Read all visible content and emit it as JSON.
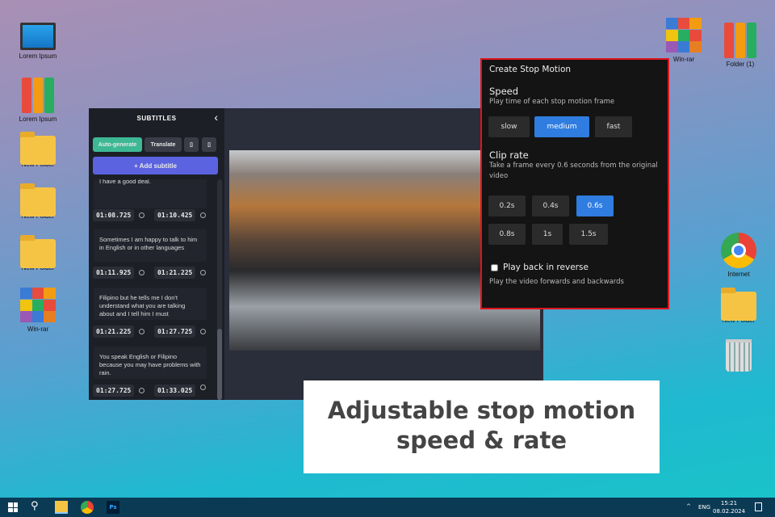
{
  "desktop": {
    "left_icons": [
      "Lorem Ipsum",
      "Lorem Ipsum",
      "New Folder",
      "New Folder",
      "New Folder",
      "Win-rar"
    ],
    "right_icons": [
      "Win-rar",
      "Folder (1)",
      "Internet",
      "New Folder"
    ]
  },
  "subtitles": {
    "title": "SUBTITLES",
    "auto_generate": "Auto-generate",
    "translate": "Translate",
    "add_subtitle": "+ Add subtitle",
    "items": [
      {
        "text": "I have a good deal.",
        "start": "01:08.725",
        "end": "01:10.425"
      },
      {
        "text": "Sometimes I am happy to talk to him in English or in other languages",
        "start": "01:11.925",
        "end": "01:21.225"
      },
      {
        "text": "Filipino but he tells me I don't understand what you are talking about and I tell him I must",
        "start": "01:21.225",
        "end": "01:27.725"
      },
      {
        "text": "You speak English or Filipino because you may have problems with rain.",
        "start": "01:27.725",
        "end": "01:33.025"
      }
    ]
  },
  "stop_motion": {
    "title": "Create Stop Motion",
    "speed_label": "Speed",
    "speed_desc": "Play time of each stop motion frame",
    "speeds": [
      "slow",
      "medium",
      "fast"
    ],
    "speed_selected": "medium",
    "clip_label": "Clip rate",
    "clip_desc": "Take a frame every 0.6 seconds from the original video",
    "rates": [
      "0.2s",
      "0.4s",
      "0.6s",
      "0.8s",
      "1s",
      "1.5s"
    ],
    "rate_selected": "0.6s",
    "reverse_label": "Play back in reverse",
    "reverse_checked": false,
    "reverse_desc": "Play the video forwards and backwards"
  },
  "caption": {
    "line1": "Adjustable stop motion",
    "line2": "speed & rate"
  },
  "taskbar": {
    "lang": "ENG",
    "time": "15:21",
    "date": "08.02.2024"
  },
  "colors": {
    "accent": "#2f7de0",
    "border": "#e0141c",
    "green": "#3db894",
    "purple": "#5b63e0"
  }
}
